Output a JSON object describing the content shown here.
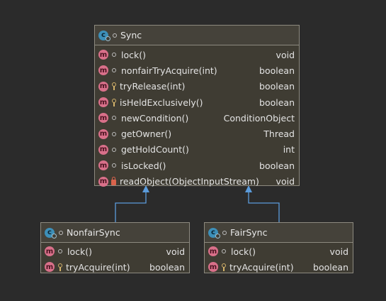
{
  "diagram": {
    "classes": [
      {
        "id": "sync",
        "title": "Sync",
        "members": [
          {
            "visibility": "package",
            "name": "lock()",
            "type": "void"
          },
          {
            "visibility": "package",
            "name": "nonfairTryAcquire(int)",
            "type": "boolean"
          },
          {
            "visibility": "protected",
            "name": "tryRelease(int)",
            "type": "boolean"
          },
          {
            "visibility": "protected",
            "name": "isHeldExclusively()",
            "type": "boolean"
          },
          {
            "visibility": "package",
            "name": "newCondition()",
            "type": "ConditionObject"
          },
          {
            "visibility": "package",
            "name": "getOwner()",
            "type": "Thread"
          },
          {
            "visibility": "package",
            "name": "getHoldCount()",
            "type": "int"
          },
          {
            "visibility": "package",
            "name": "isLocked()",
            "type": "boolean"
          },
          {
            "visibility": "private",
            "name": "readObject(ObjectInputStream)",
            "type": "void"
          }
        ]
      },
      {
        "id": "nonfair",
        "title": "NonfairSync",
        "members": [
          {
            "visibility": "package",
            "name": "lock()",
            "type": "void"
          },
          {
            "visibility": "protected",
            "name": "tryAcquire(int)",
            "type": "boolean"
          }
        ]
      },
      {
        "id": "fair",
        "title": "FairSync",
        "members": [
          {
            "visibility": "package",
            "name": "lock()",
            "type": "void"
          },
          {
            "visibility": "protected",
            "name": "tryAcquire(int)",
            "type": "boolean"
          }
        ]
      }
    ],
    "relations": [
      {
        "from": "NonfairSync",
        "to": "Sync",
        "kind": "extends"
      },
      {
        "from": "FairSync",
        "to": "Sync",
        "kind": "extends"
      }
    ],
    "icon_letters": {
      "class": "c",
      "method": "m"
    },
    "colors": {
      "link": "#5b9bdb",
      "background": "#2b2b2b",
      "box": "#3f3c33"
    }
  }
}
